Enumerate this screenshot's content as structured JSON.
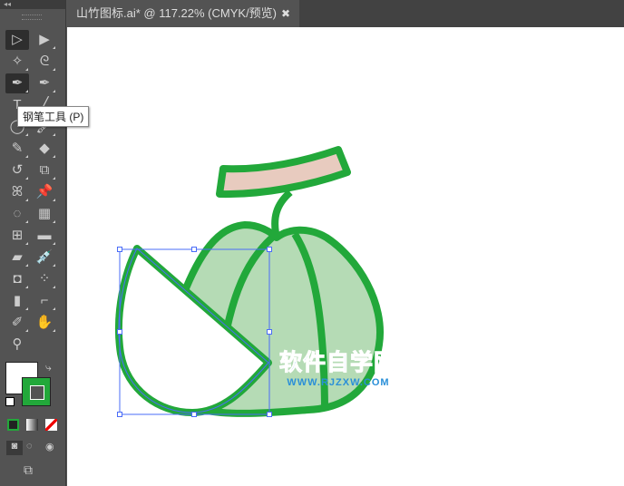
{
  "tab": {
    "title": "山竹图标.ai* @ 117.22% (CMYK/预览)",
    "close": "✖"
  },
  "toolbar": {
    "collapse": "◂◂",
    "tools": [
      {
        "name": "selection-tool",
        "glyph": "▷"
      },
      {
        "name": "direct-selection-tool",
        "glyph": "▶"
      },
      {
        "name": "magic-wand-tool",
        "glyph": "✧"
      },
      {
        "name": "lasso-tool",
        "glyph": "ᘓ"
      },
      {
        "name": "pen-tool",
        "glyph": "✒"
      },
      {
        "name": "curvature-tool",
        "glyph": "✒"
      },
      {
        "name": "type-tool",
        "glyph": "T"
      },
      {
        "name": "line-tool",
        "glyph": "╱"
      },
      {
        "name": "ellipse-tool",
        "glyph": "◯"
      },
      {
        "name": "paintbrush-tool",
        "glyph": "🖌"
      },
      {
        "name": "pencil-tool",
        "glyph": "✎"
      },
      {
        "name": "eraser-tool",
        "glyph": "◆"
      },
      {
        "name": "rotate-tool",
        "glyph": "↺"
      },
      {
        "name": "scale-tool",
        "glyph": "⧉"
      },
      {
        "name": "warp-tool",
        "glyph": "ꕤ"
      },
      {
        "name": "puppet-warp-tool",
        "glyph": "📌"
      },
      {
        "name": "shape-builder-tool",
        "glyph": "◌"
      },
      {
        "name": "perspective-grid-tool",
        "glyph": "▦"
      },
      {
        "name": "mesh-tool",
        "glyph": "⊞"
      },
      {
        "name": "gradient-tool",
        "glyph": "▬"
      },
      {
        "name": "measure-tool",
        "glyph": "▰"
      },
      {
        "name": "eyedropper-tool",
        "glyph": "💉"
      },
      {
        "name": "blend-tool",
        "glyph": "◘"
      },
      {
        "name": "symbol-sprayer-tool",
        "glyph": "⁘"
      },
      {
        "name": "column-graph-tool",
        "glyph": "▮"
      },
      {
        "name": "artboard-tool",
        "glyph": "⌐"
      },
      {
        "name": "slice-tool",
        "glyph": "✐"
      },
      {
        "name": "hand-tool",
        "glyph": "✋"
      },
      {
        "name": "zoom-tool",
        "glyph": "⚲"
      }
    ]
  },
  "tooltip": "钢笔工具 (P)",
  "colors": {
    "stroke": "#22a83a",
    "fill_light": "#b5dbb5",
    "leaf": "#e8cbbf",
    "selection": "#4a6cf7"
  },
  "watermark": {
    "cn": "软件自学网",
    "en": "WWW.RJZXW.COM"
  }
}
